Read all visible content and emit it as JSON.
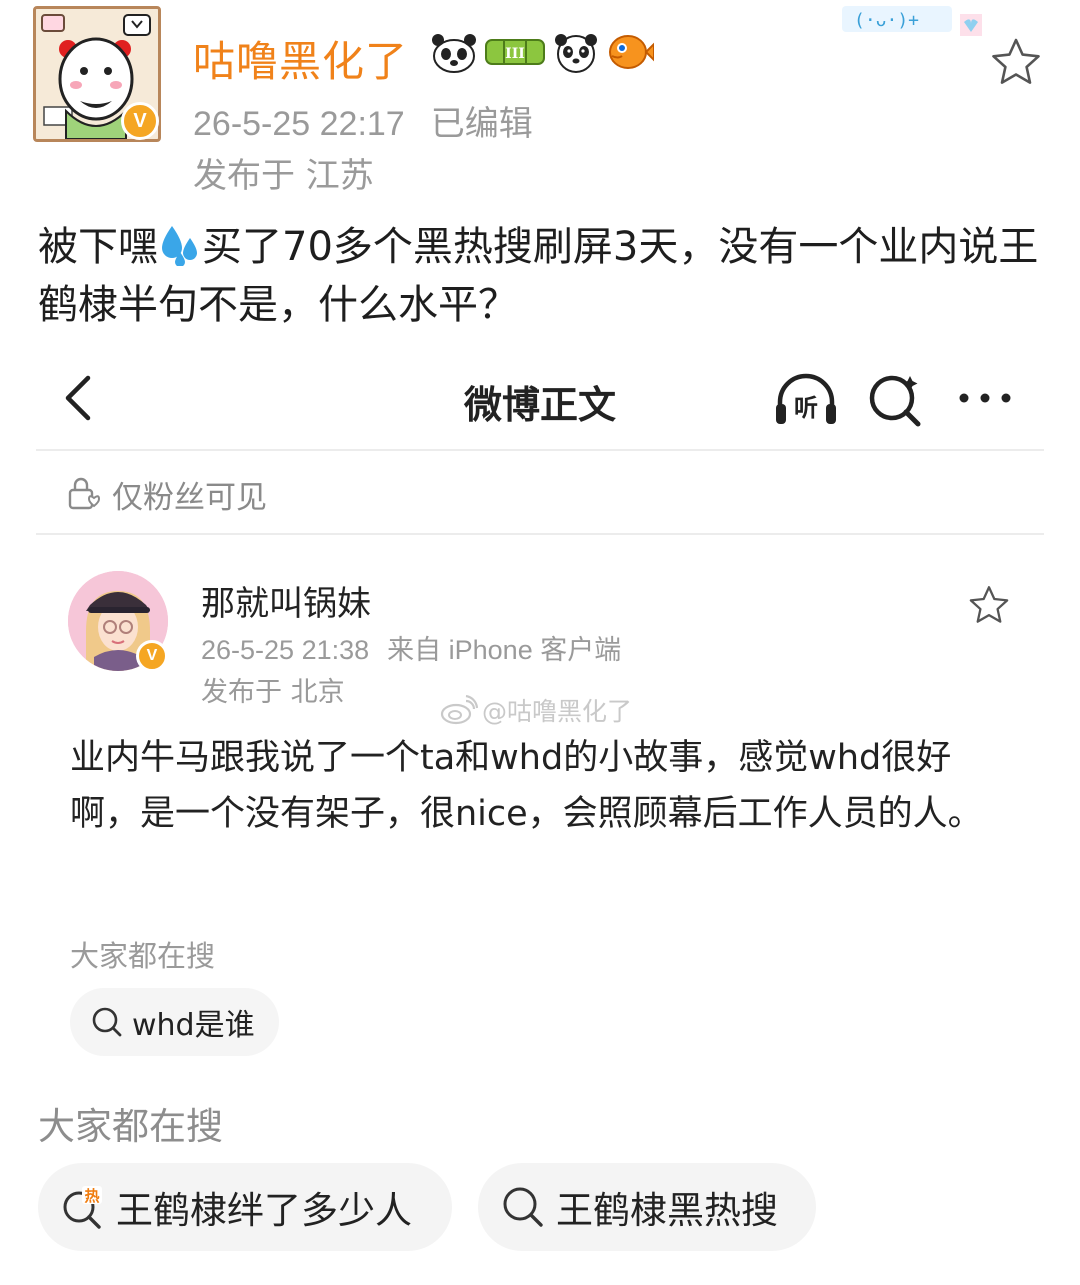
{
  "post": {
    "username": "咕噜黑化了",
    "verified_badge": "V",
    "timestamp": "26-5-25 22:17",
    "edited": "已编辑",
    "location": "发布于 江苏",
    "text_before_emoji": "被下嘿",
    "emoji": "sweat-droplets",
    "text_after_emoji": "买了70多个黑热搜刷屏3天，没有一个业内说王鹤棣半句不是，什么水平？",
    "user_badges": [
      "panda-icon",
      "bamboo-level-badge",
      "panda-face-icon",
      "pufferfish-icon"
    ]
  },
  "embedded_screenshot": {
    "nav": {
      "title": "微博正文",
      "listen_icon_label": "听"
    },
    "visibility": "仅粉丝可见",
    "author": {
      "name": "那就叫锅妹",
      "verified_badge": "V",
      "timestamp": "26-5-25 21:38",
      "source": "来自 iPhone 客户端",
      "location": "发布于 北京"
    },
    "watermark": "@咕噜黑化了",
    "text": "业内牛马跟我说了一个ta和whd的小故事，感觉whd很好啊，是一个没有架子，很nice，会照顾幕后工作人员的人。",
    "trending_label": "大家都在搜",
    "trending": [
      "whd是谁"
    ]
  },
  "trending": {
    "label": "大家都在搜",
    "items": [
      {
        "label": "王鹤棣绊了多少人",
        "icon": "hot-search-icon"
      },
      {
        "label": "王鹤棣黑热搜",
        "icon": "search-icon"
      }
    ]
  },
  "colors": {
    "username": "#f0821a",
    "verified": "#f5a623",
    "meta_text": "#9a9a9a",
    "pill_bg": "#f4f4f4"
  }
}
